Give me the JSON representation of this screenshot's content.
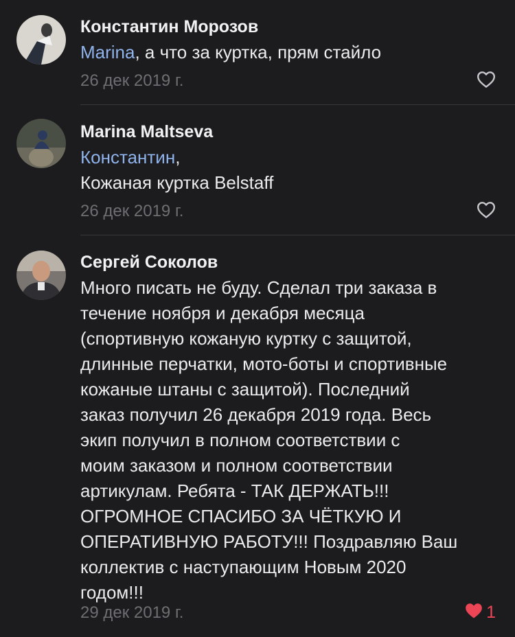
{
  "comments": [
    {
      "author": "Константин Морозов",
      "mention": "Marina",
      "text": ", а что за куртка, прям стайло",
      "date": "26 дек 2019 г.",
      "liked": false,
      "like_count": ""
    },
    {
      "author": "Marina Maltseva",
      "mention": "Константин",
      "mention_suffix": ",",
      "text": "Кожаная куртка Belstaff",
      "date": "26 дек 2019 г.",
      "liked": false,
      "like_count": ""
    },
    {
      "author": "Сергей Соколов",
      "text_lines": [
        "Много писать не буду. Сделал три заказа в",
        "течение ноября и декабря месяца",
        "(спортивную кожаную куртку с защитой,",
        "длинные перчатки, мото-боты и спортивные",
        "кожаные штаны с защитой). Последний",
        "заказ получил 26 декабря 2019 года. Весь",
        "экип получил в полном соответствии с",
        "моим заказом и полном соответствии",
        "артикулам. Ребята - ТАК ДЕРЖАТЬ!!!",
        "ОГРОМНОЕ СПАСИБО ЗА ЧЁТКУЮ И",
        "ОПЕРАТИВНУЮ РАБОТУ!!! Поздравляю Ваш",
        "коллектив с наступающим Новым 2020",
        "годом!!!"
      ],
      "date": "29 дек 2019 г.",
      "liked": true,
      "like_count": "1"
    }
  ],
  "colors": {
    "background": "#1c1c1e",
    "mention": "#8fb3ec",
    "date": "#6e6e73",
    "like_active": "#ec4556",
    "like_inactive": "#c7c7cc"
  },
  "icons": {
    "like_outline": "heart-outline-icon",
    "like_filled": "heart-filled-icon"
  }
}
